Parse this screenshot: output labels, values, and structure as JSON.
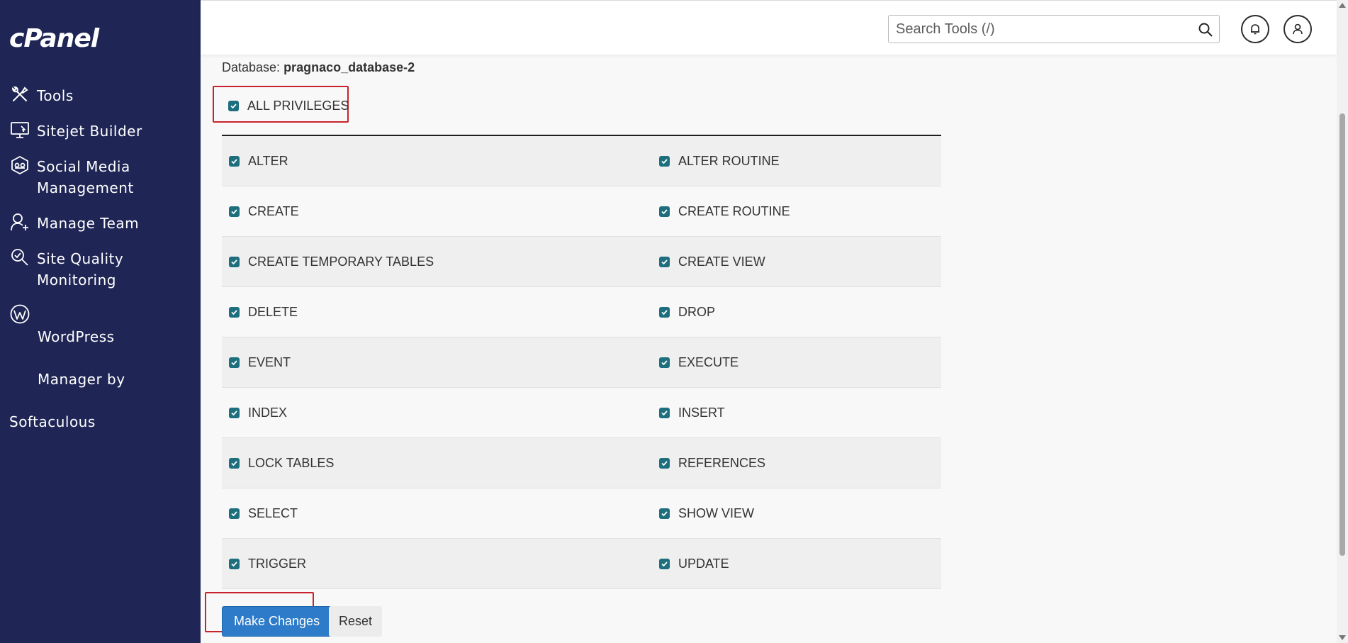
{
  "app": {
    "logo_text": "cPanel"
  },
  "sidebar": {
    "items": [
      {
        "label": "Tools",
        "icon": "tools-icon"
      },
      {
        "label": "Sitejet Builder",
        "icon": "sitejet-icon"
      },
      {
        "label": "Social Media\nManagement",
        "icon": "social-media-icon"
      },
      {
        "label": "Manage Team",
        "icon": "manage-team-icon"
      },
      {
        "label": "Site Quality\nMonitoring",
        "icon": "site-quality-icon"
      },
      {
        "label": " WordPress\n Manager by\nSoftaculous",
        "icon": "wordpress-icon"
      }
    ]
  },
  "header": {
    "search_placeholder": "Search Tools (/)",
    "notifications_icon": "bell-icon",
    "user_icon": "user-icon"
  },
  "main": {
    "database_label": "Database: ",
    "database_name": "pragnaco_database-2",
    "all_privileges": {
      "label": "ALL PRIVILEGES",
      "checked": true
    },
    "privileges": [
      {
        "left": "ALTER",
        "right": "ALTER ROUTINE"
      },
      {
        "left": "CREATE",
        "right": "CREATE ROUTINE"
      },
      {
        "left": "CREATE TEMPORARY TABLES",
        "right": "CREATE VIEW"
      },
      {
        "left": "DELETE",
        "right": "DROP"
      },
      {
        "left": "EVENT",
        "right": "EXECUTE"
      },
      {
        "left": "INDEX",
        "right": "INSERT"
      },
      {
        "left": "LOCK TABLES",
        "right": "REFERENCES"
      },
      {
        "left": "SELECT",
        "right": "SHOW VIEW"
      },
      {
        "left": "TRIGGER",
        "right": "UPDATE"
      }
    ],
    "make_changes_label": "Make Changes",
    "reset_label": "Reset"
  },
  "colors": {
    "sidebar_bg": "#1f2655",
    "checkbox": "#1d6f7e",
    "primary_button": "#2e7cc9",
    "highlight": "#c8232c"
  }
}
